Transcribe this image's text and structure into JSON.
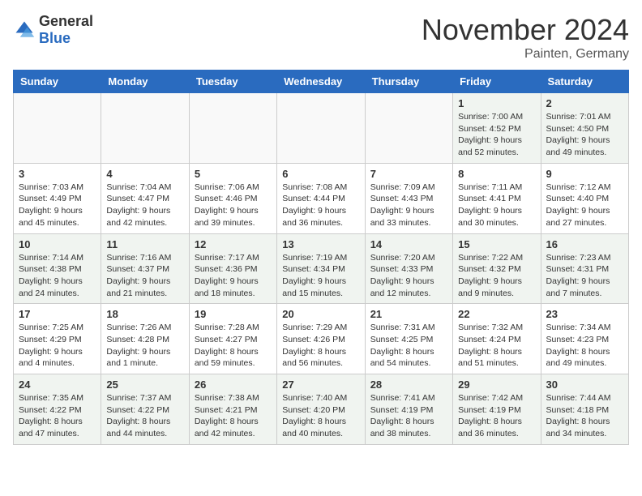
{
  "logo": {
    "general": "General",
    "blue": "Blue"
  },
  "header": {
    "month": "November 2024",
    "location": "Painten, Germany"
  },
  "weekdays": [
    "Sunday",
    "Monday",
    "Tuesday",
    "Wednesday",
    "Thursday",
    "Friday",
    "Saturday"
  ],
  "weeks": [
    [
      {
        "day": "",
        "info": ""
      },
      {
        "day": "",
        "info": ""
      },
      {
        "day": "",
        "info": ""
      },
      {
        "day": "",
        "info": ""
      },
      {
        "day": "",
        "info": ""
      },
      {
        "day": "1",
        "info": "Sunrise: 7:00 AM\nSunset: 4:52 PM\nDaylight: 9 hours and 52 minutes."
      },
      {
        "day": "2",
        "info": "Sunrise: 7:01 AM\nSunset: 4:50 PM\nDaylight: 9 hours and 49 minutes."
      }
    ],
    [
      {
        "day": "3",
        "info": "Sunrise: 7:03 AM\nSunset: 4:49 PM\nDaylight: 9 hours and 45 minutes."
      },
      {
        "day": "4",
        "info": "Sunrise: 7:04 AM\nSunset: 4:47 PM\nDaylight: 9 hours and 42 minutes."
      },
      {
        "day": "5",
        "info": "Sunrise: 7:06 AM\nSunset: 4:46 PM\nDaylight: 9 hours and 39 minutes."
      },
      {
        "day": "6",
        "info": "Sunrise: 7:08 AM\nSunset: 4:44 PM\nDaylight: 9 hours and 36 minutes."
      },
      {
        "day": "7",
        "info": "Sunrise: 7:09 AM\nSunset: 4:43 PM\nDaylight: 9 hours and 33 minutes."
      },
      {
        "day": "8",
        "info": "Sunrise: 7:11 AM\nSunset: 4:41 PM\nDaylight: 9 hours and 30 minutes."
      },
      {
        "day": "9",
        "info": "Sunrise: 7:12 AM\nSunset: 4:40 PM\nDaylight: 9 hours and 27 minutes."
      }
    ],
    [
      {
        "day": "10",
        "info": "Sunrise: 7:14 AM\nSunset: 4:38 PM\nDaylight: 9 hours and 24 minutes."
      },
      {
        "day": "11",
        "info": "Sunrise: 7:16 AM\nSunset: 4:37 PM\nDaylight: 9 hours and 21 minutes."
      },
      {
        "day": "12",
        "info": "Sunrise: 7:17 AM\nSunset: 4:36 PM\nDaylight: 9 hours and 18 minutes."
      },
      {
        "day": "13",
        "info": "Sunrise: 7:19 AM\nSunset: 4:34 PM\nDaylight: 9 hours and 15 minutes."
      },
      {
        "day": "14",
        "info": "Sunrise: 7:20 AM\nSunset: 4:33 PM\nDaylight: 9 hours and 12 minutes."
      },
      {
        "day": "15",
        "info": "Sunrise: 7:22 AM\nSunset: 4:32 PM\nDaylight: 9 hours and 9 minutes."
      },
      {
        "day": "16",
        "info": "Sunrise: 7:23 AM\nSunset: 4:31 PM\nDaylight: 9 hours and 7 minutes."
      }
    ],
    [
      {
        "day": "17",
        "info": "Sunrise: 7:25 AM\nSunset: 4:29 PM\nDaylight: 9 hours and 4 minutes."
      },
      {
        "day": "18",
        "info": "Sunrise: 7:26 AM\nSunset: 4:28 PM\nDaylight: 9 hours and 1 minute."
      },
      {
        "day": "19",
        "info": "Sunrise: 7:28 AM\nSunset: 4:27 PM\nDaylight: 8 hours and 59 minutes."
      },
      {
        "day": "20",
        "info": "Sunrise: 7:29 AM\nSunset: 4:26 PM\nDaylight: 8 hours and 56 minutes."
      },
      {
        "day": "21",
        "info": "Sunrise: 7:31 AM\nSunset: 4:25 PM\nDaylight: 8 hours and 54 minutes."
      },
      {
        "day": "22",
        "info": "Sunrise: 7:32 AM\nSunset: 4:24 PM\nDaylight: 8 hours and 51 minutes."
      },
      {
        "day": "23",
        "info": "Sunrise: 7:34 AM\nSunset: 4:23 PM\nDaylight: 8 hours and 49 minutes."
      }
    ],
    [
      {
        "day": "24",
        "info": "Sunrise: 7:35 AM\nSunset: 4:22 PM\nDaylight: 8 hours and 47 minutes."
      },
      {
        "day": "25",
        "info": "Sunrise: 7:37 AM\nSunset: 4:22 PM\nDaylight: 8 hours and 44 minutes."
      },
      {
        "day": "26",
        "info": "Sunrise: 7:38 AM\nSunset: 4:21 PM\nDaylight: 8 hours and 42 minutes."
      },
      {
        "day": "27",
        "info": "Sunrise: 7:40 AM\nSunset: 4:20 PM\nDaylight: 8 hours and 40 minutes."
      },
      {
        "day": "28",
        "info": "Sunrise: 7:41 AM\nSunset: 4:19 PM\nDaylight: 8 hours and 38 minutes."
      },
      {
        "day": "29",
        "info": "Sunrise: 7:42 AM\nSunset: 4:19 PM\nDaylight: 8 hours and 36 minutes."
      },
      {
        "day": "30",
        "info": "Sunrise: 7:44 AM\nSunset: 4:18 PM\nDaylight: 8 hours and 34 minutes."
      }
    ]
  ]
}
